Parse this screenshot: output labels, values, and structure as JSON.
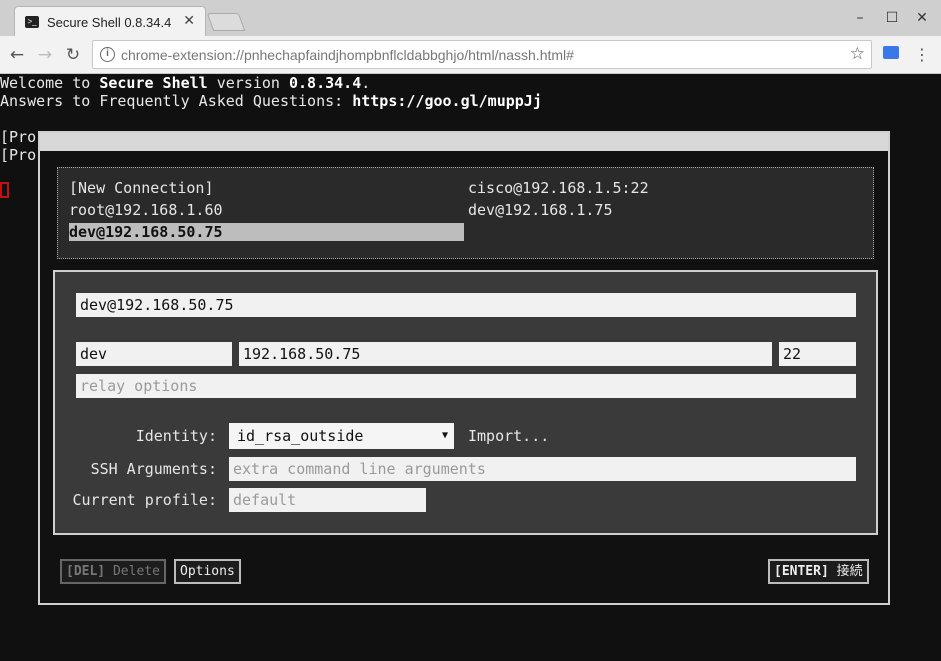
{
  "browser": {
    "tab_title": "Secure Shell 0.8.34.4",
    "tab_icon": ">_",
    "tab_close": "✕",
    "url": "chrome-extension://pnhechapfaindjhompbnflcldabbghjo/html/nassh.html#",
    "icons": {
      "back": "←",
      "forward": "→",
      "reload": "↻",
      "star": "☆",
      "minimize": "–",
      "maximize": "☐",
      "close": "✕",
      "menu": "⋮",
      "info": "i"
    }
  },
  "terminal": {
    "line1_pre": "Welcome to ",
    "line1_app": "Secure Shell",
    "line1_mid": " version ",
    "line1_ver": "0.8.34.4",
    "line1_post": ".",
    "line2_pre": "Answers to Frequently Asked Questions: ",
    "line2_link": "https://goo.gl/muppJj",
    "line3": "[Pro",
    "line4": "[Pro"
  },
  "profiles": {
    "items": [
      {
        "label": "[New Connection]"
      },
      {
        "label": "cisco@192.168.1.5:22"
      },
      {
        "label": "root@192.168.1.60"
      },
      {
        "label": "dev@192.168.1.75"
      },
      {
        "label": "dev@192.168.50.75",
        "selected": true
      }
    ]
  },
  "form": {
    "description": "dev@192.168.50.75",
    "username": "dev",
    "hostname": "192.168.50.75",
    "port": "22",
    "relay_placeholder": "relay options",
    "identity_label": "Identity:",
    "identity_value": "id_rsa_outside",
    "identity_arrow": "▼",
    "import_label": "Import...",
    "ssh_args_label": "SSH Arguments:",
    "ssh_args_placeholder": "extra command line arguments",
    "profile_label": "Current profile:",
    "profile_placeholder": "default"
  },
  "buttons": {
    "delete_key": "[DEL]",
    "delete_label": " Delete",
    "options_label": "Options",
    "connect_key": "[ENTER]",
    "connect_label": " 接続"
  }
}
